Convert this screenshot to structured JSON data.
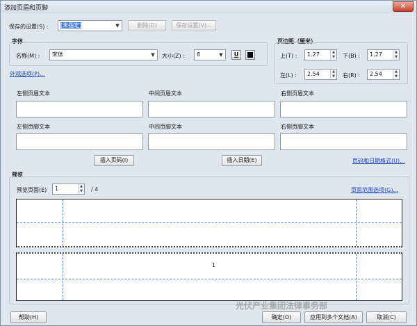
{
  "window": {
    "title": "添加页眉和页脚",
    "close_glyph": "✕"
  },
  "saved_settings": {
    "label": "保存的设置(S) :",
    "value": "[未指定]",
    "delete_label": "删除(D)",
    "save_label": "保存设置(V)..."
  },
  "font": {
    "group_label": "字体",
    "name_label": "名称(M) :",
    "name_value": "宋体",
    "size_label": "大小(Z) :",
    "size_value": "8",
    "underline_glyph": "U",
    "appearance_link": "外观选项(P)..."
  },
  "margins": {
    "group_label": "页边距（厘米）",
    "top_label": "上(T) :",
    "top_value": "1.27",
    "bottom_label": "下(B) :",
    "bottom_value": "1.27",
    "left_label": "左(L) :",
    "left_value": "2.54",
    "right_label": "右(R) :",
    "right_value": "2.54"
  },
  "header_footer": {
    "left_header": "左侧页眉文本",
    "center_header": "中间页眉文本",
    "right_header": "右侧页眉文本",
    "left_footer": "左侧页脚文本",
    "center_footer": "中间页脚文本",
    "right_footer": "右侧页脚文本",
    "insert_page_number": "插入页码(I)",
    "insert_date": "插入日期(E)",
    "page_date_format_link": "页码和日期格式(U)..."
  },
  "preview": {
    "group_label": "预览",
    "page_label": "预览页面(E)",
    "page_value": "1",
    "total_pages": "/ 4",
    "page_range_link": "页面范围选项(G)...",
    "footer_page_number": "1"
  },
  "bottom": {
    "help": "帮助(H)",
    "ok": "确定(O)",
    "apply_multiple": "应用到多个文档(A)",
    "cancel": "取消(C)",
    "watermark": "光伏产业集团法律事务部"
  }
}
